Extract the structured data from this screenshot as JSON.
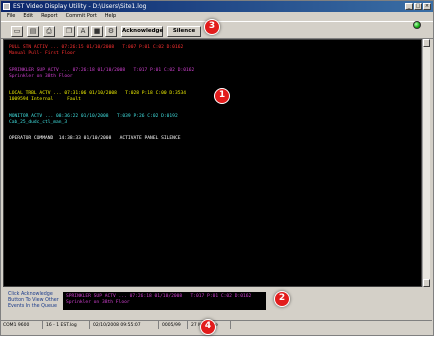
{
  "window": {
    "title": "EST Video Display Utility - D:\\Users\\Site1.log"
  },
  "menu": [
    "File",
    "Edit",
    "Report",
    "Commit Port",
    "Help"
  ],
  "toolbar": {
    "acknowledge_label": "Acknowledge",
    "silence_label": "Silence"
  },
  "colors": {
    "fire": "#ff3030",
    "supervisory": "#d040d0",
    "trouble": "#f0f000",
    "monitor": "#40e0e0",
    "operator": "#ffffff"
  },
  "events": [
    {
      "line1": "PULL STN ACTIV ... 07:26:15 01/10/2008   T:007 P:01 C:02 D:0162",
      "line2": "Manual Pull- First Floor",
      "color": "#ff3030"
    },
    {
      "line1": "SPRINKLER SUP ACTV ... 07:26:18 01/10/2008   T:017 P:01 C:02 D:0162",
      "line2": "Sprinkler on 38th Floor",
      "color": "#d040d0"
    },
    {
      "line1": "LOCAL TRBL ACTV ... 07:31:06 01/10/2008   T:028 P:18 C:00 D:3534",
      "line2": "1009594 Internal     Fault",
      "color": "#f0f000"
    },
    {
      "line1": "MONITOR ACTV ... 08:36:22 01/10/2008   T:039 P:26 C:02 D:0192",
      "line2": "Cab_25_dudc_ctl_man_3",
      "color": "#40e0e0"
    },
    {
      "line1": "OPERATOR COMMAND  14:38:33 01/10/2008   ACTIVATE PANEL SILENCE",
      "line2": "",
      "color": "#ffffff"
    }
  ],
  "queue": {
    "hint": "Click Acknowledge Button To View Other Events In the Queue",
    "line1": "SPRINKLER SUP ACTV ... 07:26:18 01/10/2008   T:017 P:01 C:02 D:0162",
    "line2": "Sprinkler on 38th Floor"
  },
  "status": [
    "COM1 9600",
    "16 - 1  EST.log",
    "02/10/2008 09:55:07",
    "0005/99",
    "27 Message"
  ],
  "badges": [
    "1",
    "2",
    "3",
    "4"
  ]
}
